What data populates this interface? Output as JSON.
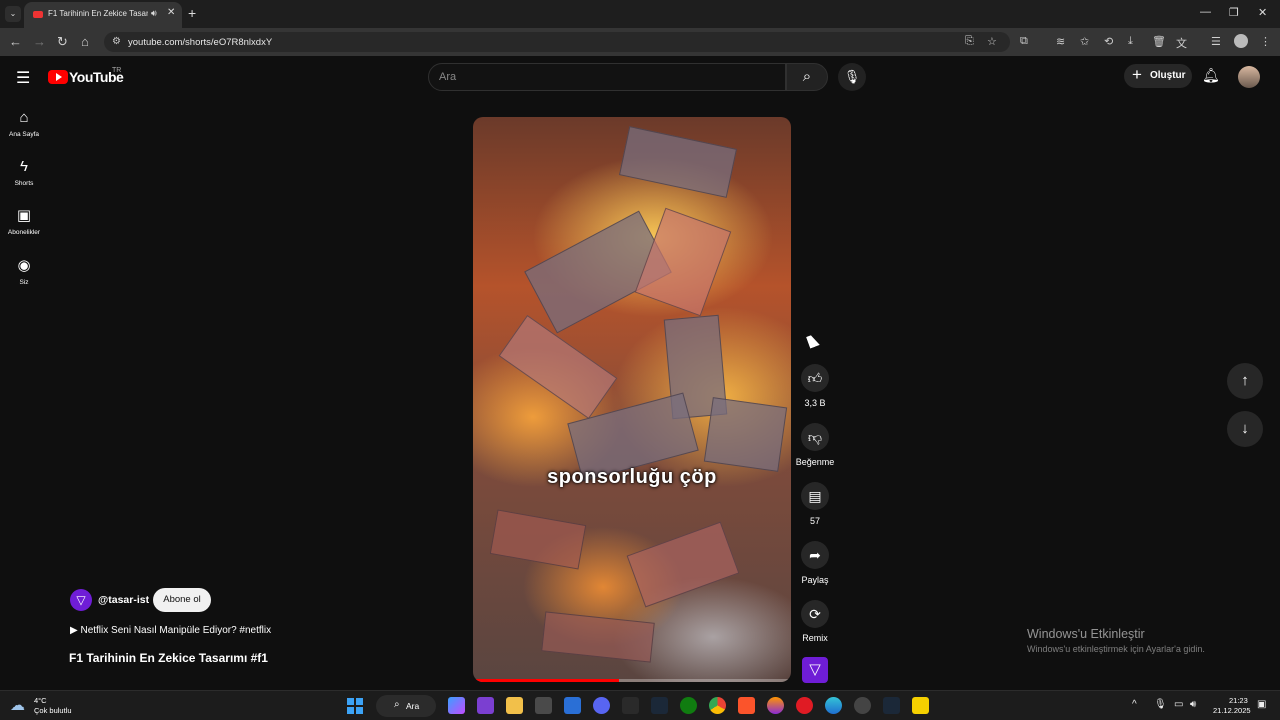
{
  "browser": {
    "tab_title": "F1 Tarihinin En Zekice Tasarımı",
    "url": "youtube.com/shorts/eO7R8nlxdxY"
  },
  "youtube": {
    "logo_text": "YouTube",
    "country_code": "TR",
    "search_placeholder": "Ara",
    "create_label": "Oluştur"
  },
  "sidebar": {
    "items": [
      {
        "label": "Ana Sayfa",
        "icon": "home-icon"
      },
      {
        "label": "Shorts",
        "icon": "shorts-icon"
      },
      {
        "label": "Abonelikler",
        "icon": "subscriptions-icon"
      },
      {
        "label": "Siz",
        "icon": "you-icon"
      }
    ]
  },
  "video": {
    "caption": "sponsorluğu çöp",
    "progress_fraction": 0.46
  },
  "actions": {
    "like_count": "3,3 B",
    "dislike_label": "Beğenme",
    "comment_count": "57",
    "share_label": "Paylaş",
    "remix_label": "Remix"
  },
  "channel": {
    "handle": "@tasar-ist",
    "subscribe_label": "Abone ol",
    "related_link": "▶ Netflix Seni Nasıl Manipüle Ediyor? #netflix",
    "video_title": "F1 Tarihinin En Zekice Tasarımı #f1"
  },
  "watermark": {
    "title": "Windows'u Etkinleştir",
    "subtitle": "Windows'u etkinleştirmek için Ayarlar'a gidin."
  },
  "taskbar": {
    "temperature": "4°C",
    "weather": "Çok bulutlu",
    "search_label": "Ara",
    "time": "21:23",
    "date": "21.12.2025"
  },
  "colors": {
    "accent_red": "#ff0000",
    "channel_purple": "#6f1dd6"
  }
}
